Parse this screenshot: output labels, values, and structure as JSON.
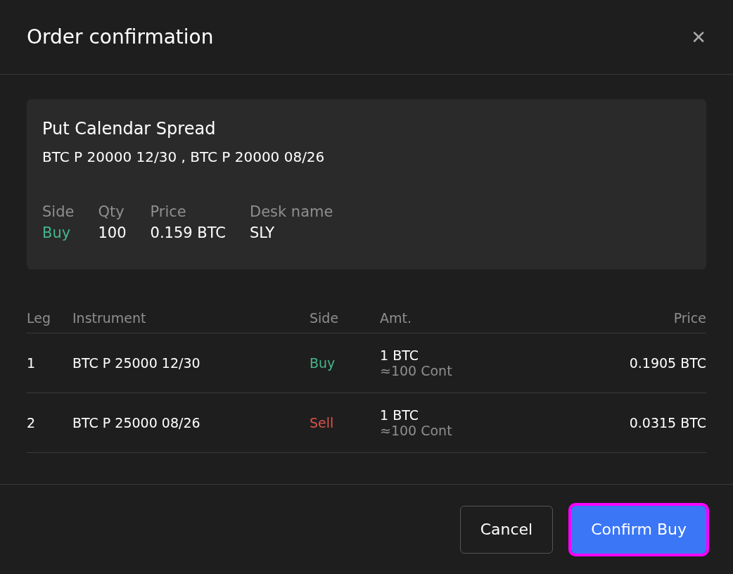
{
  "dialog": {
    "title": "Order confirmation",
    "close_glyph": "✕"
  },
  "summary": {
    "title": "Put Calendar Spread",
    "instruments": "BTC P 20000 12/30 , BTC P 20000 08/26",
    "fields": [
      {
        "label": "Side",
        "value": "Buy",
        "color": "#45b58a"
      },
      {
        "label": "Qty",
        "value": "100",
        "color": "#ffffff"
      },
      {
        "label": "Price",
        "value": "0.159 BTC",
        "color": "#ffffff"
      },
      {
        "label": "Desk name",
        "value": "SLY",
        "color": "#ffffff"
      }
    ]
  },
  "table": {
    "columns": [
      "Leg",
      "Instrument",
      "Side",
      "Amt.",
      "Price"
    ],
    "rows": [
      {
        "leg": "1",
        "instrument": "BTC P 25000 12/30",
        "side": "Buy",
        "color": "#45b58a",
        "amount": "1 BTC",
        "contracts": "≈100 Cont",
        "price": "0.1905 BTC"
      },
      {
        "leg": "2",
        "instrument": "BTC P 25000 08/26",
        "side": "Sell",
        "color": "#d9534a",
        "amount": "1 BTC",
        "contracts": "≈100 Cont",
        "price": "0.0315 BTC"
      }
    ]
  },
  "buttons": [
    {
      "label": "Cancel",
      "kind": "secondary",
      "focused": false
    },
    {
      "label": "Confirm Buy",
      "kind": "primary",
      "focused": true
    }
  ]
}
